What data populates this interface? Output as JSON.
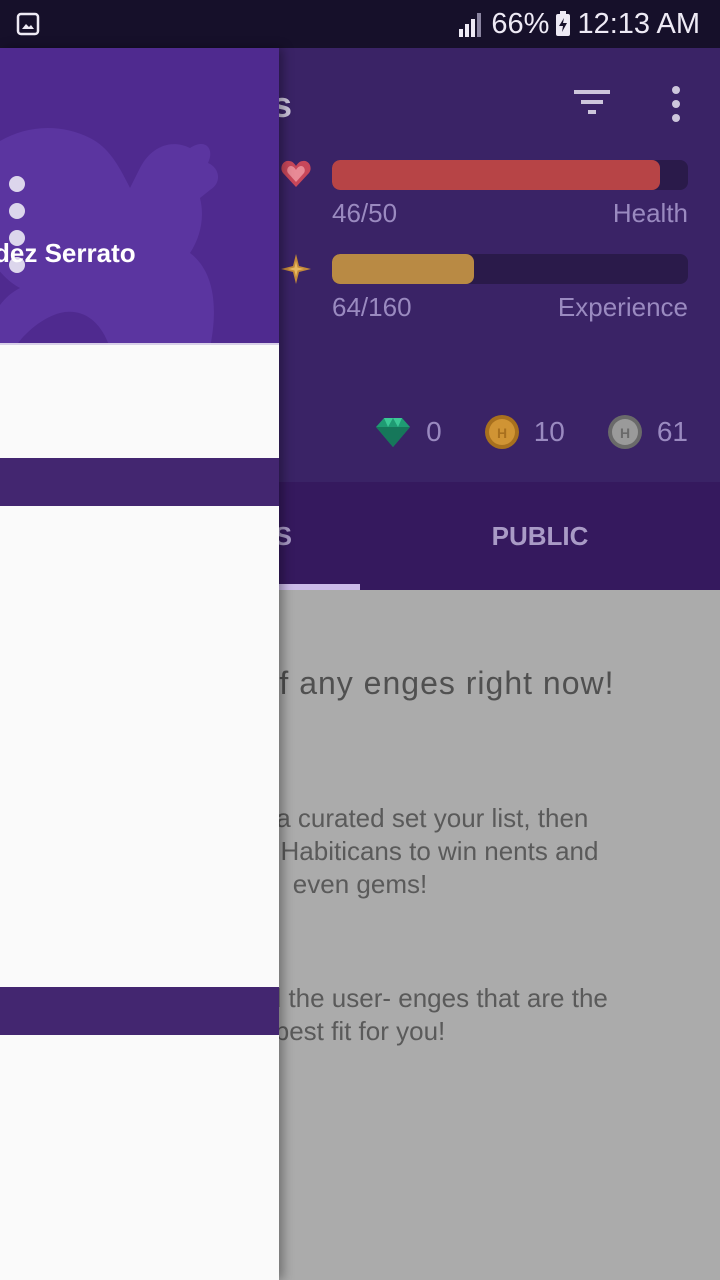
{
  "status_bar": {
    "battery": "66%",
    "time": "12:13 AM"
  },
  "toolbar": {
    "title": "ges"
  },
  "stats": {
    "health": {
      "value_text": "46/50",
      "label": "Health",
      "current": 46,
      "max": 50,
      "color": "#b74446"
    },
    "experience": {
      "value_text": "64/160",
      "label": "Experience",
      "current": 64,
      "max": 160,
      "color": "#b98a44"
    }
  },
  "currency": {
    "gems": "0",
    "gold": "10",
    "silver": "61"
  },
  "tabs": [
    {
      "label": "S"
    },
    {
      "label": "PUBLIC"
    }
  ],
  "empty_state": {
    "title": "e not part of any enges right now!",
    "description": "enge to add a curated set your list, then compete ther Habiticans to win nents and even gems!",
    "hint": "blic” tab to find the user- enges that are the best fit for you!"
  },
  "drawer": {
    "user_name": "dez Serrato"
  },
  "colors": {
    "primary": "#4f2a8f",
    "toolbar": "#3a2366",
    "tab_bar": "#35195e",
    "accent": "#cbbbe8"
  }
}
